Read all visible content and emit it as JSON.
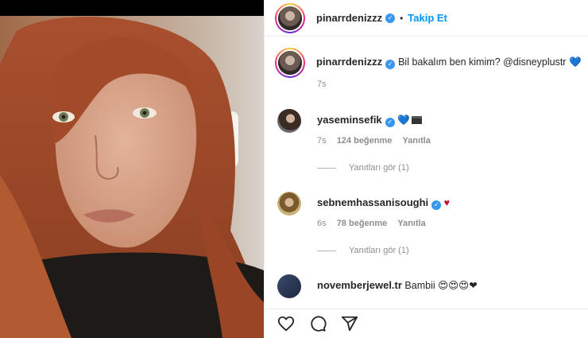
{
  "post": {
    "username": "pinarrdenizzz",
    "follow_label": "Takip Et",
    "dot": "•",
    "caption_text": "Bil bakalım ben kimim? @disneyplustr",
    "caption_emoji": "💙",
    "timestamp": "7s"
  },
  "comments": [
    {
      "username": "yaseminsefik",
      "text": "💙",
      "time": "7s",
      "likes": "124 beğenme",
      "reply": "Yanıtla",
      "view_replies": "Yanıtları gör (1)"
    },
    {
      "username": "sebnemhassanisoughi",
      "text": "♥",
      "time": "6s",
      "likes": "78 beğenme",
      "reply": "Yanıtla",
      "view_replies": "Yanıtları gör (1)"
    },
    {
      "username": "novemberjewel.tr",
      "text": "Bambii 😍😍😍❤"
    }
  ],
  "icons": {
    "like": "heart-icon",
    "comment": "comment-icon",
    "share": "share-icon"
  },
  "colors": {
    "link_blue": "#0095f6",
    "verified_blue": "#3897f0",
    "meta_gray": "#8e8e8e"
  }
}
